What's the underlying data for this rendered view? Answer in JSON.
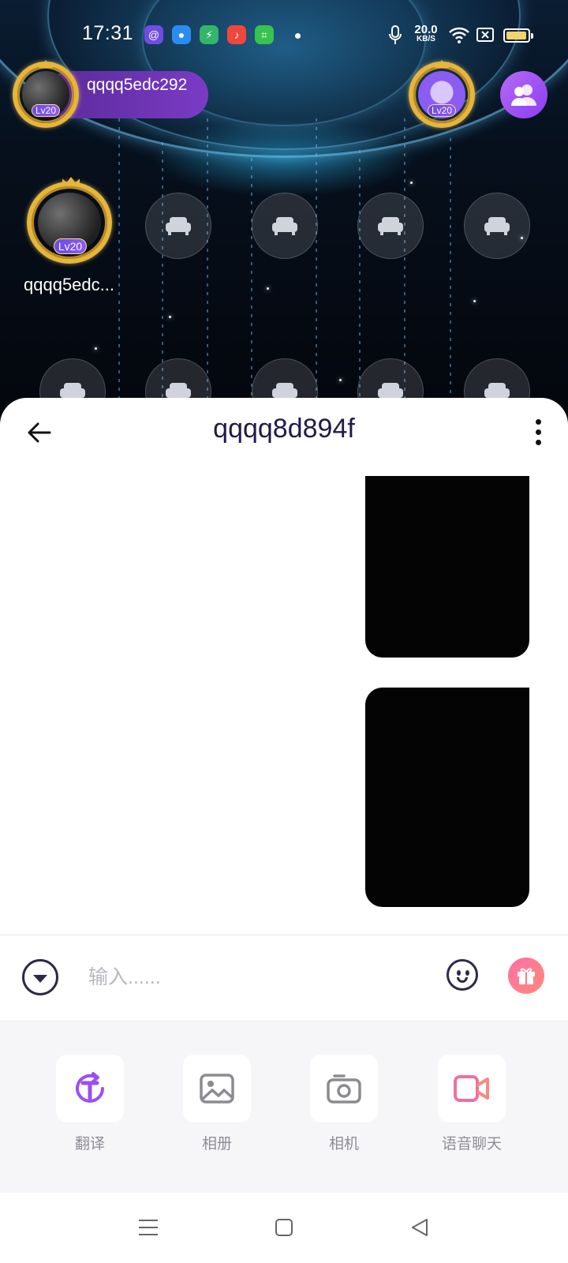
{
  "status_bar": {
    "time": "17:31",
    "net_speed_value": "20.0",
    "net_speed_unit": "KB/S",
    "notification_icons": [
      "threads-app-icon",
      "browser-app-icon",
      "shield-app-icon",
      "music-app-icon",
      "store-app-icon"
    ],
    "battery_level": 0.95,
    "battery_color": "#f4d36a"
  },
  "room": {
    "host_name": "qqqq5edc292",
    "host_level": "Lv20",
    "viewer_level": "Lv20",
    "seat_owner_name": "qqqq5edc...",
    "seat_owner_level": "Lv20",
    "empty_seat_icon": "sofa-icon",
    "users_button_icon": "users-icon"
  },
  "chat": {
    "title": "qqqq8d894f",
    "messages": [
      {
        "type": "image",
        "content": ""
      },
      {
        "type": "image",
        "content": ""
      }
    ],
    "input_placeholder": "输入......",
    "input_value": ""
  },
  "tools": [
    {
      "id": "translate",
      "label": "翻译",
      "icon": "translate-icon",
      "color": "#9b4ef5"
    },
    {
      "id": "album",
      "label": "相册",
      "icon": "image-icon",
      "color": "#8b8b92"
    },
    {
      "id": "camera",
      "label": "相机",
      "icon": "camera-icon",
      "color": "#8b8b92"
    },
    {
      "id": "voice-chat",
      "label": "语音聊天",
      "icon": "video-icon",
      "color": "#f0709f"
    }
  ],
  "colors": {
    "accent": "#8c3df0",
    "title_text": "#221a4a",
    "gift_button": "#ff6fa5"
  }
}
